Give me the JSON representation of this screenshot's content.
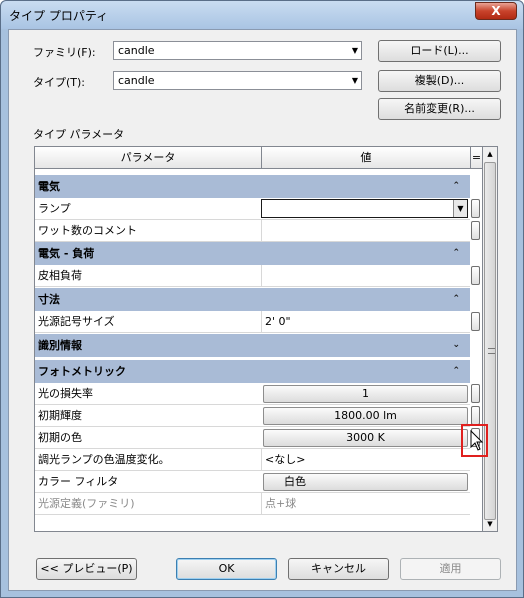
{
  "window": {
    "title": "タイプ プロパティ",
    "close_label": "X"
  },
  "family": {
    "label": "ファミリ(F):",
    "value": "candle"
  },
  "type": {
    "label": "タイプ(T):",
    "value": "candle"
  },
  "buttons": {
    "load": "ロード(L)...",
    "duplicate": "複製(D)...",
    "rename": "名前変更(R)...",
    "preview": "<< プレビュー(P)",
    "ok": "OK",
    "cancel": "キャンセル",
    "apply": "適用"
  },
  "type_params_label": "タイプ パラメータ",
  "grid": {
    "col_param": "パラメータ",
    "col_value": "値",
    "col_extra": "=",
    "categories": {
      "electrical": "電気",
      "electrical_load": "電気 - 負荷",
      "dimensions": "寸法",
      "identity": "識別情報",
      "photometrics": "フォトメトリック"
    },
    "rows": {
      "lamp": {
        "name": "ランプ",
        "value": ""
      },
      "wattage_comment": {
        "name": "ワット数のコメント",
        "value": ""
      },
      "apparent_load": {
        "name": "皮相負荷",
        "value": ""
      },
      "symbol_size": {
        "name": "光源記号サイズ",
        "value": "2'  0\""
      },
      "light_loss": {
        "name": "光の損失率",
        "value": "1"
      },
      "initial_intensity": {
        "name": "初期輝度",
        "value": "1800.00 lm"
      },
      "initial_color": {
        "name": "初期の色",
        "value": "3000 K"
      },
      "dimming_shift": {
        "name": "調光ランプの色温度変化。",
        "value": "<なし>"
      },
      "color_filter": {
        "name": "カラー フィルタ",
        "value": "白色"
      },
      "light_source_def": {
        "name": "光源定義(ファミリ)",
        "value": "点+球"
      }
    }
  },
  "colors": {
    "category_bg": "#a9bbd6",
    "highlight": "#e0201e"
  }
}
